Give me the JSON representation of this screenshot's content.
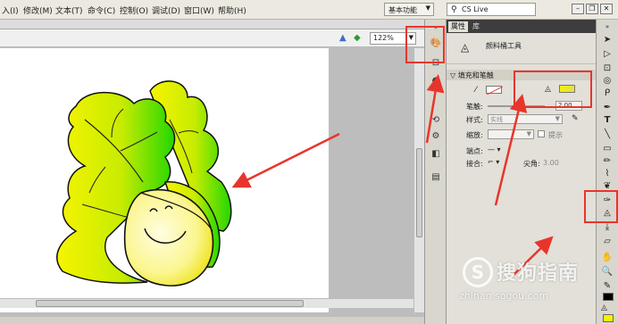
{
  "menubar": {
    "items": [
      "入(I)",
      "修改(M)",
      "文本(T)",
      "命令(C)",
      "控制(O)",
      "调试(D)",
      "窗口(W)",
      "帮助(H)"
    ],
    "workspace": "基本功能",
    "search_label": "CS Live"
  },
  "edit_bar": {
    "zoom": "122%"
  },
  "panel": {
    "tabs": [
      "属性",
      "库"
    ],
    "tool_name": "颜料桶工具",
    "section_title": "填充和笔触",
    "stroke_label": "笔触:",
    "stroke_value": "2.00",
    "style_label": "样式:",
    "style_value": "实线",
    "scale_label": "缩放:",
    "hint_label": "提示",
    "cap_label": "端点:",
    "join_label": "接合:",
    "miter_label": "尖角:",
    "miter_value": "3.00"
  },
  "watermark": {
    "main": "搜狗指南",
    "url": "zhinan.sogou.com",
    "logo": "S"
  },
  "colors": {
    "accent_red": "#e8352c",
    "fill_yellow": "#f4f200",
    "leaf_green": "#22d600"
  }
}
